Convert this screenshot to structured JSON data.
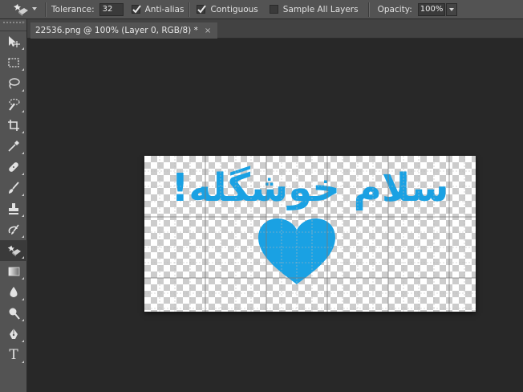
{
  "options_bar": {
    "tolerance_label": "Tolerance:",
    "tolerance_value": "32",
    "antialias_label": "Anti-alias",
    "antialias_checked": true,
    "contiguous_label": "Contiguous",
    "contiguous_checked": true,
    "sample_all_layers_label": "Sample All Layers",
    "sample_all_layers_checked": false,
    "opacity_label": "Opacity:",
    "opacity_value": "100%"
  },
  "document_tab": {
    "title": "22536.png @ 100% (Layer 0, RGB/8) *",
    "close_glyph": "×"
  },
  "toolbar": {
    "collapse_glyph": "»",
    "tools": [
      {
        "id": "move",
        "icon": "move-icon"
      },
      {
        "id": "marquee",
        "icon": "rect-marquee-icon"
      },
      {
        "id": "lasso",
        "icon": "lasso-icon"
      },
      {
        "id": "quick-selection",
        "icon": "quick-selection-icon"
      },
      {
        "id": "crop",
        "icon": "crop-icon"
      },
      {
        "id": "eyedropper",
        "icon": "eyedropper-icon"
      },
      {
        "id": "healing",
        "icon": "bandage-icon"
      },
      {
        "id": "brush",
        "icon": "brush-icon"
      },
      {
        "id": "stamp",
        "icon": "stamp-icon"
      },
      {
        "id": "history-brush",
        "icon": "history-brush-icon"
      },
      {
        "id": "eraser",
        "icon": "magic-eraser-icon",
        "active": true
      },
      {
        "id": "gradient",
        "icon": "gradient-icon"
      },
      {
        "id": "blur",
        "icon": "blur-icon"
      },
      {
        "id": "dodge",
        "icon": "dodge-icon"
      },
      {
        "id": "pen",
        "icon": "pen-icon"
      },
      {
        "id": "type",
        "icon": "type-icon",
        "glyph": "T"
      }
    ]
  },
  "artwork": {
    "text": "سلام خوشگله!",
    "color": "#1aa1e3",
    "shape": "heart-icon"
  },
  "colors": {
    "ui_panel": "#535353",
    "workspace": "#282828",
    "artwork_blue": "#1aa1e3"
  }
}
